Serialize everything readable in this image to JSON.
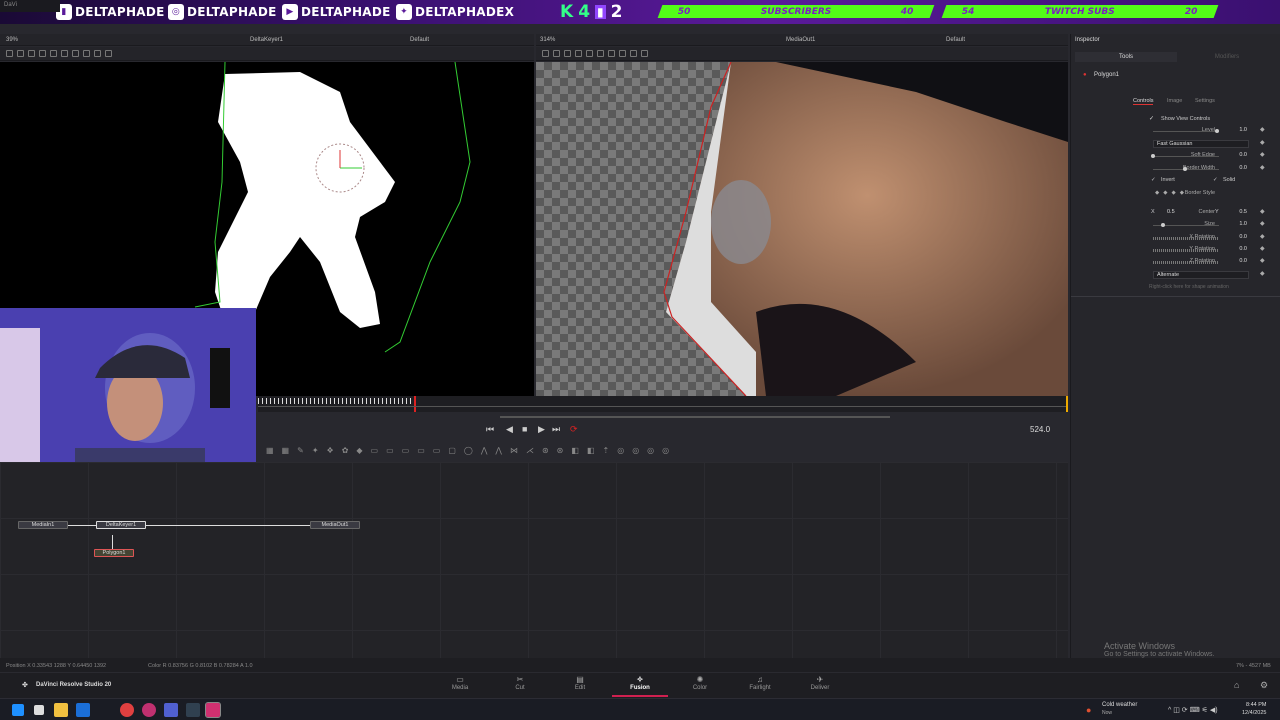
{
  "window": {
    "title": "DaVi"
  },
  "banner": {
    "socials": [
      {
        "icon": "twitch-icon",
        "name": "DELTAPHADE"
      },
      {
        "icon": "instagram-icon",
        "name": "DELTAPHADE"
      },
      {
        "icon": "youtube-icon",
        "name": "DELTAPHADE"
      },
      {
        "icon": "twitter-icon",
        "name": "DELTAPHADEX"
      }
    ],
    "k4": [
      "K",
      "4"
    ],
    "twitch_count": "2",
    "goals": [
      {
        "current": "50",
        "label": "SUBSCRIBERS",
        "target": "40"
      },
      {
        "current": "54",
        "label": "TWITCH SUBS",
        "target": "20"
      }
    ]
  },
  "viewer_left": {
    "zoom": "39%",
    "title": "DeltaKeyer1",
    "view": "Default"
  },
  "viewer_right": {
    "zoom": "314%",
    "title": "MediaOut1",
    "view": "Default"
  },
  "timeline": {
    "current_frame": "524.0"
  },
  "nodes": [
    {
      "id": "MediaIn1"
    },
    {
      "id": "DeltaKeyer1"
    },
    {
      "id": "MediaOut1"
    },
    {
      "id": "Polygon1"
    }
  ],
  "inspector": {
    "title": "Inspector",
    "tab_tools": "Tools",
    "tab_modifiers": "Modifiers",
    "node_name": "Polygon1",
    "subtabs": [
      "Controls",
      "Image",
      "Settings"
    ],
    "show_view_controls": "Show View Controls",
    "level": {
      "label": "Level",
      "value": "1.0"
    },
    "filter": {
      "label": "Filter",
      "value": "Fast Gaussian"
    },
    "soft_edge": {
      "label": "Soft Edge",
      "value": "0.0"
    },
    "border_width": {
      "label": "Border Width",
      "value": "0.0"
    },
    "invert": "Invert",
    "solid": "Solid",
    "border_style": "Border Style",
    "center": {
      "label": "Center",
      "x_label": "X",
      "x": "0.5",
      "y_label": "Y",
      "y": "0.5"
    },
    "size": {
      "label": "Size",
      "value": "1.0"
    },
    "x_rotation": {
      "label": "X Rotation",
      "value": "0.0"
    },
    "y_rotation": {
      "label": "Y Rotation",
      "value": "0.0"
    },
    "z_rotation": {
      "label": "Z Rotation",
      "value": "0.0"
    },
    "fill_method": {
      "label": "Fill Method",
      "value": "Alternate"
    },
    "hint": "Right-click here for shape animation"
  },
  "status": {
    "position": "Position  X 0.33543   1288   Y 0.64450   1392",
    "color": "Color  R 0.83756     G 0.8102     B 0.78284   A 1.0",
    "memory": "7% - 4527 MB"
  },
  "watermark": {
    "title": "Activate Windows",
    "sub": "Go to Settings to activate Windows."
  },
  "app": {
    "name": "DaVinci Resolve Studio 20"
  },
  "pages": [
    "Media",
    "Cut",
    "Edit",
    "Fusion",
    "Color",
    "Fairlight",
    "Deliver"
  ],
  "taskbar": {
    "weather_title": "Cold weather",
    "weather_sub": "Now",
    "time": "8:44 PM",
    "date": "12/4/2025"
  }
}
